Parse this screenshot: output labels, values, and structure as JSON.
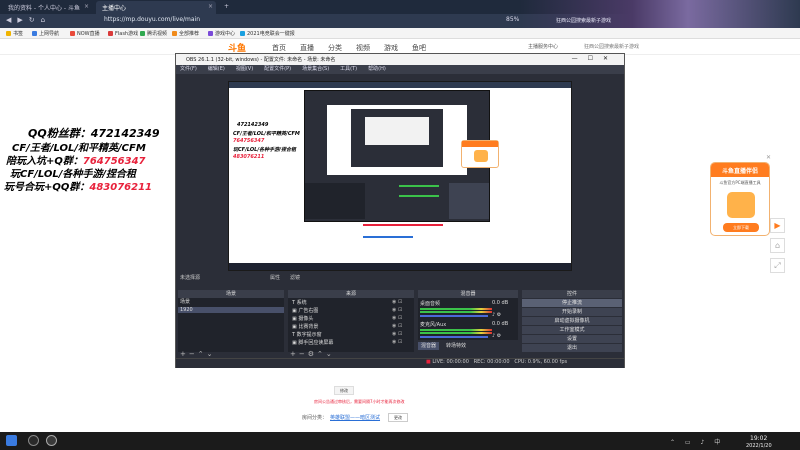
{
  "browser": {
    "tabs": [
      {
        "label": "我的资料 - 个人中心 - 斗鱼",
        "active": false
      },
      {
        "label": "主播中心",
        "active": true
      }
    ],
    "new_tab": "+",
    "window_controls": "— ❐ ✕",
    "url": "https://mp.douyu.com/live/main",
    "zoom": "85%",
    "hero_text": "狂西公园搜索最新子游戏",
    "bookmarks": [
      "书签",
      "上网导航",
      "NOW直播",
      "Flash游戏",
      "腾讯视频",
      "全部推荐",
      "游戏中心",
      "2021电竞联会一键报"
    ]
  },
  "site": {
    "logo": "斗鱼",
    "nav": [
      "首页",
      "直播",
      "分类",
      "视频",
      "游戏",
      "鱼吧"
    ],
    "user": "主播服务中心",
    "right_text": "狂西公园搜索最新子游戏"
  },
  "overlay_ads": {
    "line1": {
      "label": "QQ粉丝群：",
      "value": "472142349"
    },
    "line2": {
      "label": "CF/王者/LOL/和平精英/CFM"
    },
    "line3": {
      "label": "陪玩入坑+Q群：",
      "value": "764756347"
    },
    "line4": {
      "label": "玩CF/LOL/各种手游/捏合租"
    },
    "line5": {
      "label": "玩号合玩+QQ群：",
      "value": "483076211"
    }
  },
  "obs": {
    "title": "OBS 26.1.1 (32-bit, windows) - 配置文件: 未命名 - 场景: 未命名",
    "menu": [
      "文件(F)",
      "编辑(E)",
      "视图(V)",
      "配置文件(P)",
      "场景集合(S)",
      "工具(T)",
      "帮助(H)"
    ],
    "source_bar": "未选择源",
    "source_bar_buttons": [
      "属性",
      "滤镜"
    ],
    "docks": {
      "scenes": {
        "title": "场景",
        "items": [
          "场景",
          "1920"
        ],
        "selected": 1
      },
      "sources": {
        "title": "来源",
        "items": [
          "系统",
          "广告右图",
          "摄像头",
          "比赛背景",
          "数字提示窗",
          "脚手回应读屏幕"
        ]
      },
      "mixer": {
        "title": "混音器",
        "channels": [
          {
            "name": "桌面音频",
            "db": "0.0 dB"
          },
          {
            "name": "麦克风/Aux",
            "db": "0.0 dB"
          }
        ],
        "tabs": [
          "混音器",
          "转场特效"
        ]
      },
      "controls": {
        "title": "控件",
        "buttons": [
          "停止推流",
          "开始录制",
          "启动虚拟摄像机",
          "工作室模式",
          "设置",
          "退出"
        ]
      }
    },
    "status": {
      "live": "LIVE: 00:00:00",
      "rec": "REC: 00:00:00",
      "cpu": "CPU: 0.9%, 60.00 fps"
    }
  },
  "promo": {
    "title": "斗鱼直播伴侣",
    "subtitle": "斗鱼官方PC端直播工具",
    "button": "立即下载",
    "close": "✕"
  },
  "side_buttons": [
    "▶",
    "⌂",
    "⤢"
  ],
  "bottom": {
    "button": "修改",
    "red_note": "房间公告通过审核后，需要间隔7小时才能再次修改",
    "room_label": "房间分类：",
    "room_link": "英雄联盟——暗区测试",
    "modify": "更改"
  },
  "taskbar": {
    "time": "19:02",
    "date": "2022/1/20",
    "tray": "⌃ ▭ ♪ 中"
  },
  "colors": {
    "accent": "#ff7700",
    "obs_bg": "#2b2e38",
    "ad_red": "#e8213b"
  }
}
